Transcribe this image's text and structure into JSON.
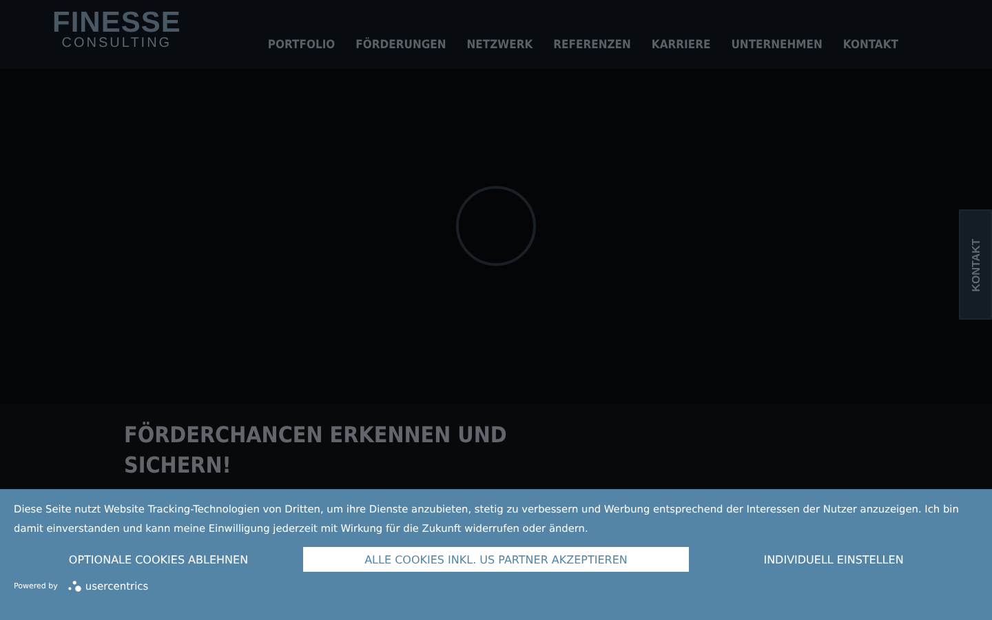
{
  "header": {
    "logo": {
      "title": "FINESSE",
      "subtitle": "CONSULTING"
    },
    "nav": [
      {
        "label": "PORTFOLIO"
      },
      {
        "label": "FÖRDERUNGEN"
      },
      {
        "label": "NETZWERK"
      },
      {
        "label": "REFERENZEN"
      },
      {
        "label": "KARRIERE"
      },
      {
        "label": "UNTERNEHMEN"
      },
      {
        "label": "KONTAKT"
      }
    ]
  },
  "side_tab": {
    "label": "KONTAKT"
  },
  "section": {
    "heading": "FÖRDERCHANCEN ERKENNEN UND SICHERN!"
  },
  "cookie_banner": {
    "text": "Diese Seite nutzt Website Tracking-Technologien von Dritten, um ihre Dienste anzubieten, stetig zu verbessern und Werbung entsprechend der Interessen der Nutzer anzuzeigen. Ich bin damit einverstanden und kann meine Einwilligung jederzeit mit Wirkung für die Zukunft widerrufen oder ändern.",
    "buttons": [
      {
        "label": "OPTIONALE COOKIES ABLEHNEN",
        "kind": "plain"
      },
      {
        "label": "ALLE COOKIES INKL. US PARTNER AKZEPTIEREN",
        "kind": "primary"
      },
      {
        "label": "INDIVIDUELL EINSTELLEN",
        "kind": "plain"
      }
    ],
    "powered_by": "Powered by",
    "brand": "usercentrics"
  }
}
